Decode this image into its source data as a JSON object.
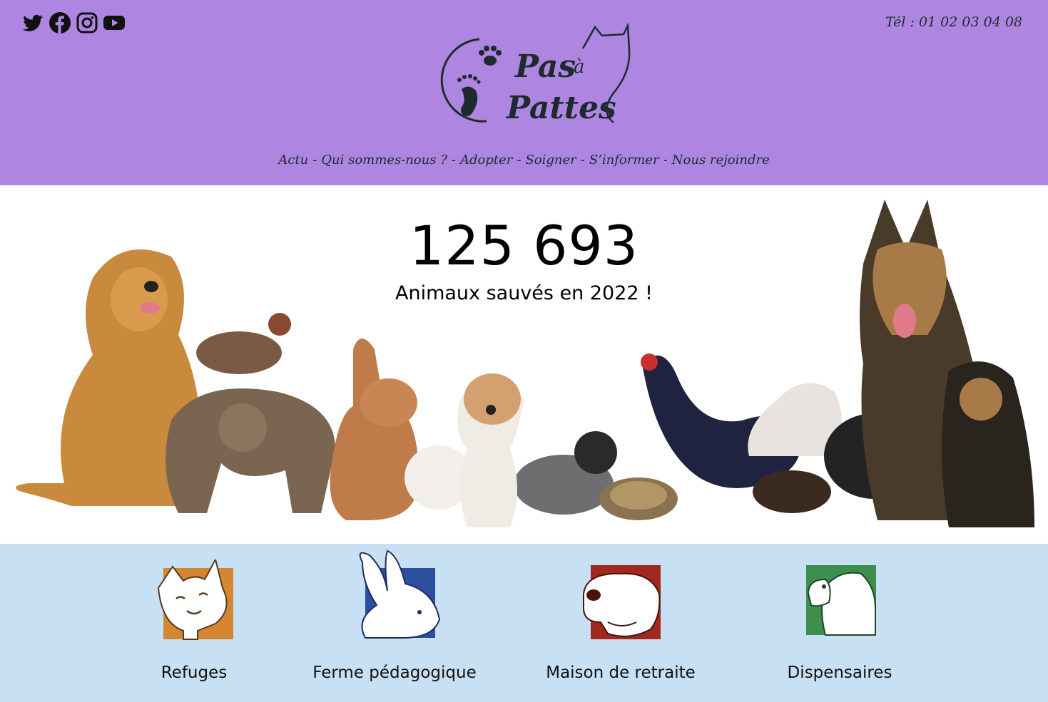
{
  "header": {
    "socials": [
      {
        "name": "twitter-icon"
      },
      {
        "name": "facebook-icon"
      },
      {
        "name": "instagram-icon"
      },
      {
        "name": "youtube-icon"
      }
    ],
    "phone": "Tél : 01 02 03 04 08",
    "logo_text": "Pas à Pattes",
    "nav": [
      {
        "label": "Actu"
      },
      {
        "label": "Qui sommes-nous ?"
      },
      {
        "label": "Adopter"
      },
      {
        "label": "Soigner"
      },
      {
        "label": "S’informer"
      },
      {
        "label": "Nous rejoindre"
      }
    ],
    "nav_separator": "-"
  },
  "hero": {
    "count": "125 693",
    "caption": "Animaux sauvés en 2022 !"
  },
  "services": [
    {
      "label": "Refuges",
      "icon": "cat-icon",
      "color": "#d58632"
    },
    {
      "label": "Ferme pédagogique",
      "icon": "rabbit-icon",
      "color": "#2c4fa0"
    },
    {
      "label": "Maison de retraite",
      "icon": "dog-icon",
      "color": "#a0281f"
    },
    {
      "label": "Dispensaires",
      "icon": "parrot-icon",
      "color": "#3e8f4e"
    }
  ],
  "colors": {
    "header_bg": "#ae86e2",
    "services_bg": "#c7e0f4",
    "text_dark": "#1e2b2e"
  }
}
